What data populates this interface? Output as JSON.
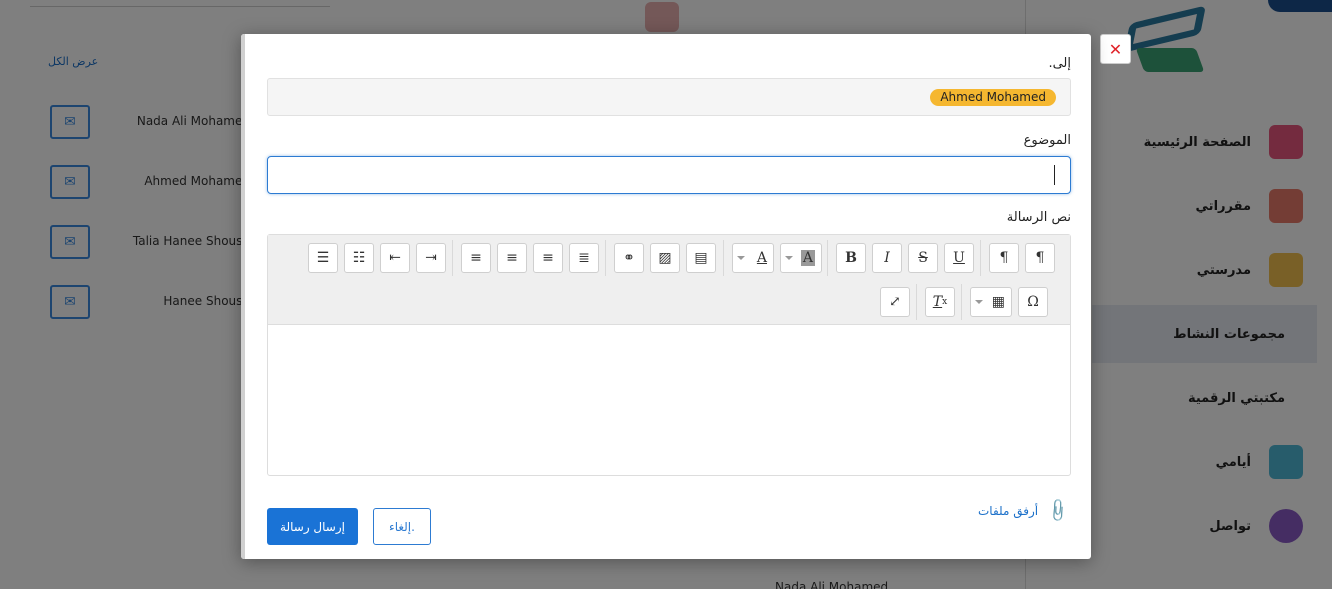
{
  "background": {
    "view_all": "عرض الكل",
    "contacts": [
      {
        "name": "Nada Ali Mohamed"
      },
      {
        "name": "Ahmed Mohamed"
      },
      {
        "name": "Talia Hanee Shoush"
      },
      {
        "name": "Hanee Shoush"
      }
    ],
    "bottom_text": "Nada Ali Mohamed",
    "nav": [
      {
        "label": "الصفحة الرئيسية",
        "icon": "home-icon",
        "color": "#e8577e"
      },
      {
        "label": "مقرراتي",
        "icon": "book-icon",
        "color": "#e87b6a"
      },
      {
        "label": "مدرستي",
        "icon": "school-icon",
        "color": "#f2c14e"
      },
      {
        "label": "مجموعات النشاط",
        "icon": "groups-icon",
        "color": "",
        "active": true
      },
      {
        "label": "مكتبتي الرقمية",
        "icon": "library-icon",
        "color": ""
      },
      {
        "label": "أيامي",
        "icon": "calendar-icon",
        "color": "#4fb8d6"
      },
      {
        "label": "تواصل",
        "icon": "chat-icon",
        "color": "#8a5bc7"
      }
    ]
  },
  "modal": {
    "close_icon": "close-icon",
    "to_label": "إلى.",
    "recipient": "Ahmed Mohamed",
    "subject_label": "الموضوع",
    "subject_value": "",
    "body_label": "نص الرسالة",
    "toolbar_row1": [
      {
        "name": "ordered-list-icon",
        "glyph": "☰"
      },
      {
        "name": "bullet-list-icon",
        "glyph": "☷"
      },
      {
        "name": "outdent-icon",
        "glyph": "⇤"
      },
      {
        "name": "indent-icon",
        "glyph": "⇥"
      },
      {
        "name": "align-left-icon",
        "glyph": "≡"
      },
      {
        "name": "align-center-icon",
        "glyph": "≡"
      },
      {
        "name": "align-right-icon",
        "glyph": "≡"
      },
      {
        "name": "align-justify-icon",
        "glyph": "≣"
      },
      {
        "name": "link-icon",
        "glyph": "🔗"
      },
      {
        "name": "image-icon",
        "glyph": "▨"
      },
      {
        "name": "video-icon",
        "glyph": "▤"
      },
      {
        "name": "font-color-icon",
        "glyph": "A"
      },
      {
        "name": "background-color-icon",
        "glyph": "A"
      },
      {
        "name": "bold-icon",
        "glyph": "B"
      },
      {
        "name": "italic-icon",
        "glyph": "I"
      },
      {
        "name": "strikethrough-icon",
        "glyph": "S"
      },
      {
        "name": "underline-icon",
        "glyph": "U"
      },
      {
        "name": "rtl-paragraph-icon",
        "glyph": "¶"
      },
      {
        "name": "ltr-paragraph-icon",
        "glyph": "¶"
      }
    ],
    "toolbar_row2": [
      {
        "name": "fullscreen-icon",
        "glyph": "⤢"
      },
      {
        "name": "clear-format-icon",
        "glyph": "T"
      },
      {
        "name": "table-icon",
        "glyph": "▦"
      },
      {
        "name": "special-char-icon",
        "glyph": "Ω"
      }
    ],
    "attach_label": "أرفق ملفات",
    "cancel_label": "إلغاء.",
    "send_label": "إرسال رسالة"
  }
}
